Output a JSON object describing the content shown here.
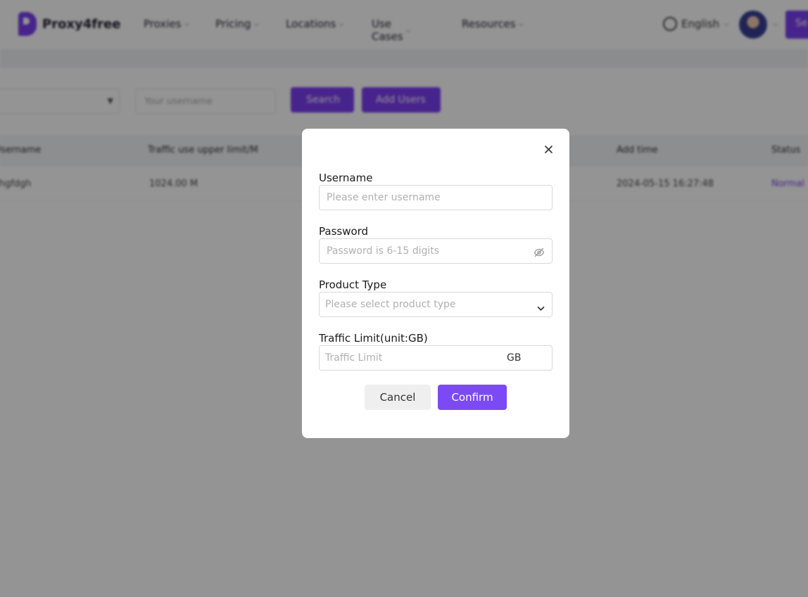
{
  "header": {
    "brand": "Proxy4free",
    "nav": [
      {
        "label": "Proxies"
      },
      {
        "label": "Pricing"
      },
      {
        "label": "Locations"
      },
      {
        "label": "Use Cases"
      },
      {
        "label": "Resources"
      }
    ],
    "language": "English",
    "cta_label": "Se"
  },
  "toolbar": {
    "search_placeholder": "Your username",
    "search_label": "Search",
    "add_label": "Add Users"
  },
  "table": {
    "columns": [
      "Username",
      "Traffic use upper limit/M",
      "Add time",
      "Status"
    ],
    "rows": [
      {
        "username": "fhgfdgh",
        "traffic": "1024.00 M",
        "add_time": "2024-05-15 16:27:48",
        "status": "Normal"
      }
    ]
  },
  "modal": {
    "username_label": "Username",
    "username_placeholder": "Please enter username",
    "password_label": "Password",
    "password_placeholder": "Password is 6-15 digits",
    "product_type_label": "Product Type",
    "product_type_placeholder": "Please select product type",
    "traffic_label": "Traffic Limit(unit:GB)",
    "traffic_placeholder": "Traffic Limit",
    "traffic_unit": "GB",
    "cancel_label": "Cancel",
    "confirm_label": "Confirm"
  },
  "colors": {
    "accent": "#7b4af5",
    "overlay": "rgba(0,0,0,0.42)"
  }
}
